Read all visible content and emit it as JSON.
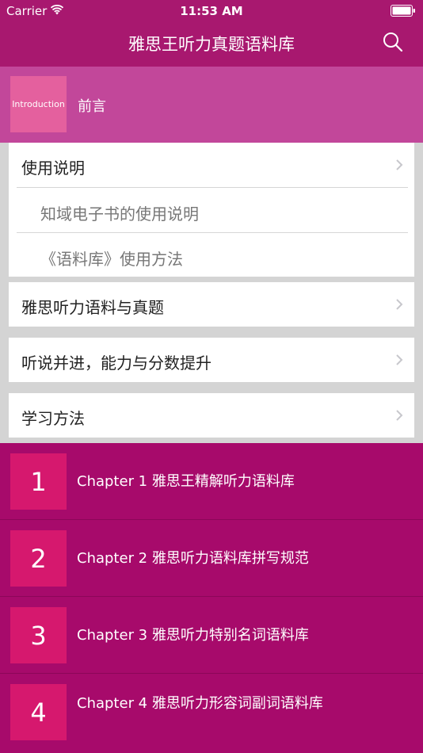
{
  "status_bar": {
    "carrier": "Carrier",
    "time": "11:53 AM"
  },
  "header": {
    "title": "雅思王听力真题语料库"
  },
  "intro": {
    "tile_label": "Introduction",
    "label": "前言"
  },
  "section1": {
    "title": "使用说明",
    "sub_items": [
      "知域电子书的使用说明",
      "《语料库》使用方法"
    ]
  },
  "sections": [
    {
      "label": "雅思听力语料与真题"
    },
    {
      "label": "听说并进，能力与分数提升"
    },
    {
      "label": "学习方法"
    }
  ],
  "chapters": [
    {
      "number": "1",
      "title": "Chapter 1 雅思王精解听力语料库"
    },
    {
      "number": "2",
      "title": "Chapter 2 雅思听力语料库拼写规范"
    },
    {
      "number": "3",
      "title": "Chapter 3 雅思听力特别名词语料库"
    },
    {
      "number": "4",
      "title": "Chapter 4 雅思听力形容词副词语料库"
    }
  ],
  "colors": {
    "header_bg": "#a8186f",
    "intro_bg": "#c2479a",
    "chapter_bg": "#a70a6b",
    "chapter_tile": "#d6186e"
  }
}
